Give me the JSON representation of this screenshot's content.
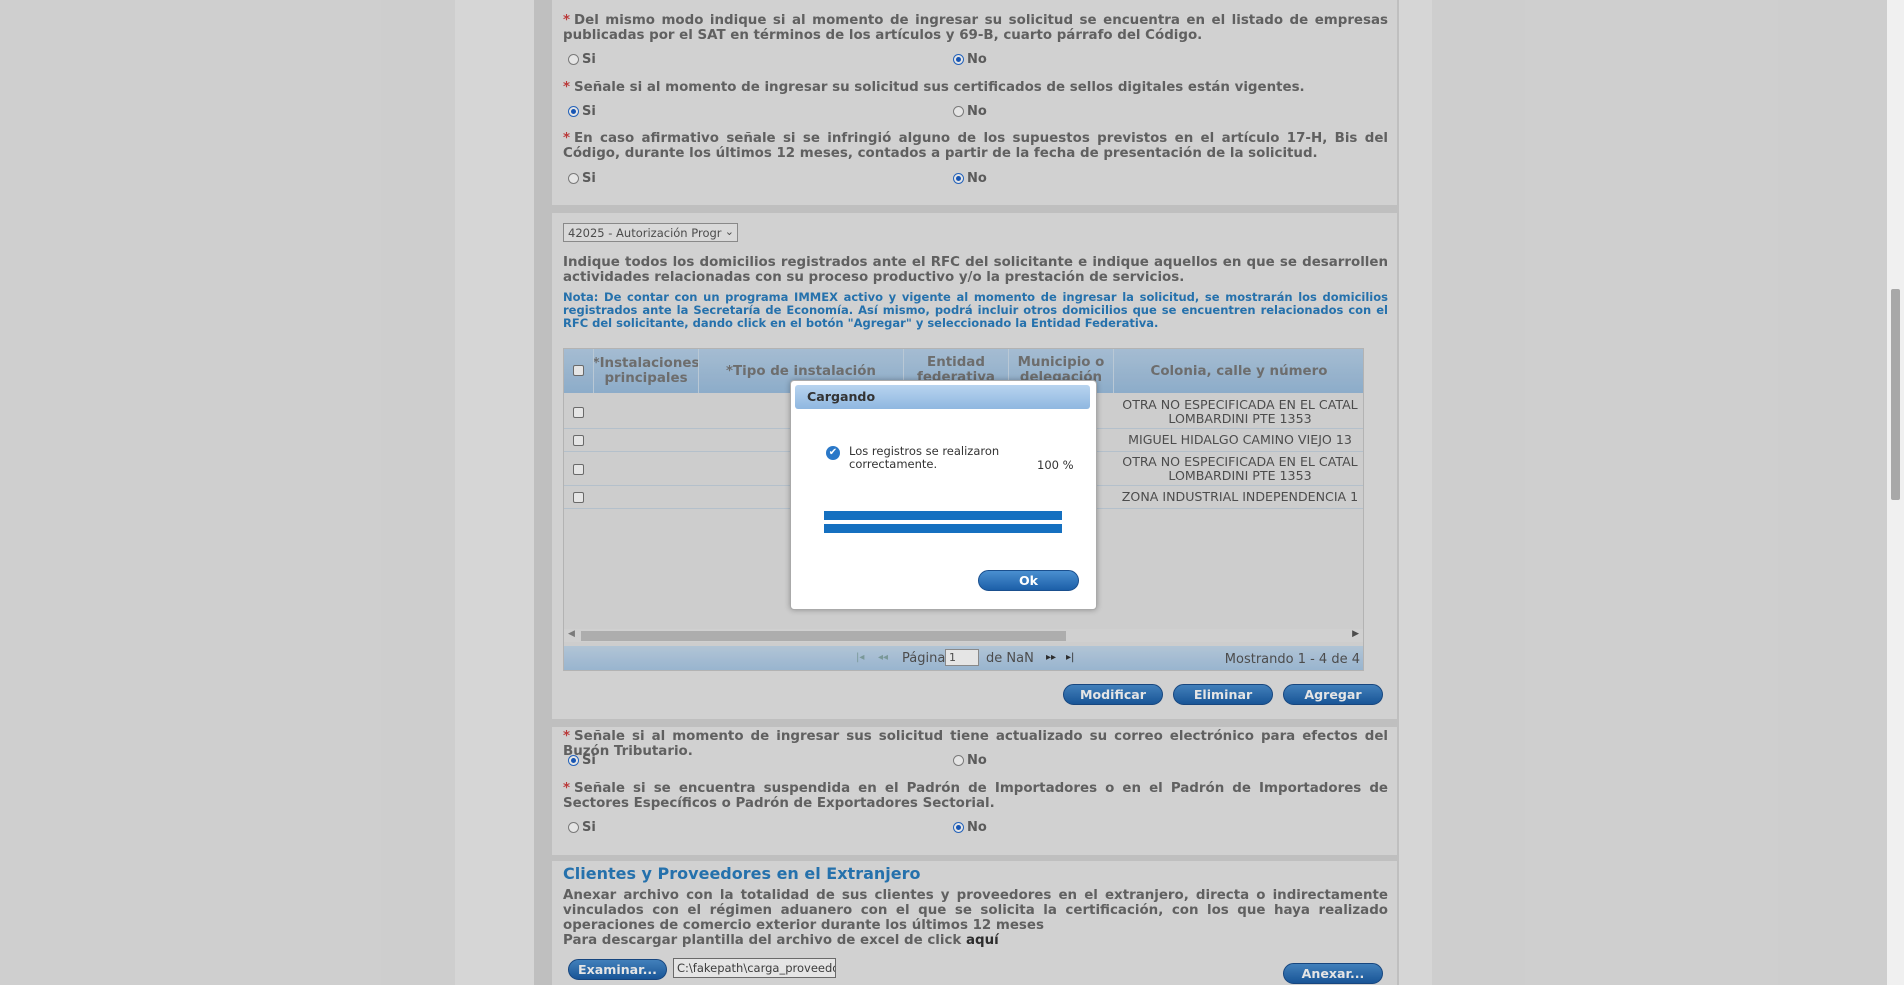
{
  "questions": {
    "q1": {
      "text": "Del mismo modo indique si al momento de ingresar su solicitud se encuentra en el listado de empresas publicadas por el SAT en términos de los artículos y 69-B, cuarto párrafo del Código.",
      "yes": "Si",
      "no": "No"
    },
    "q2": {
      "text": "Señale si al momento de ingresar su solicitud sus certificados de sellos digitales están vigentes.",
      "yes": "Si",
      "no": "No"
    },
    "q3": {
      "text": "En caso afirmativo señale si se infringió alguno de los supuestos previstos en el artículo 17-H, Bis del Código, durante los últimos 12 meses, contados a partir de la fecha de presentación de la solicitud.",
      "yes": "Si",
      "no": "No"
    },
    "q4": {
      "text": "Señale si al momento de ingresar sus solicitud tiene actualizado su correo electrónico para efectos del Buzón Tributario.",
      "yes": "Si",
      "no": "No"
    },
    "q5": {
      "text": "Señale si se encuentra suspendida en el Padrón de Importadores o en el Padrón de Importadores de Sectores Específicos o Padrón de Exportadores Sectorial.",
      "yes": "Si",
      "no": "No"
    }
  },
  "program_select": {
    "value": "42025 - Autorización Progr"
  },
  "domicilios": {
    "description": "Indique todos los domicilios registrados ante el RFC del solicitante e indique aquellos en que se desarrollen actividades relacionadas con su proceso productivo y/o la prestación de servicios.",
    "note": "Nota: De contar con un programa IMMEX activo y vigente al momento de ingresar la solicitud, se mostrarán los domicilios registrados ante la Secretaría de Economía. Así mismo, podrá incluir otros domicilios que se encuentren relacionados con el RFC del solicitante, dando click en el botón \"Agregar\" y seleccionado la Entidad Federativa."
  },
  "grid": {
    "headers": [
      "*Instalaciones principales",
      "*Tipo de instalación",
      "Entidad federativa",
      "Municipio o delegación",
      "Colonia, calle y número"
    ],
    "rows": [
      {
        "colonia_l1": "OTRA NO ESPECIFICADA EN EL CATAL",
        "colonia_l2": "LOMBARDINI PTE 1353"
      },
      {
        "colonia_l1": "MIGUEL HIDALGO CAMINO VIEJO 13",
        "colonia_l2": ""
      },
      {
        "colonia_l1": "OTRA NO ESPECIFICADA EN EL CATAL",
        "colonia_l2": "LOMBARDINI PTE 1353"
      },
      {
        "colonia_l1": "ZONA INDUSTRIAL INDEPENDENCIA 1",
        "colonia_l2": ""
      }
    ],
    "pager": {
      "page_label": "Página",
      "page_value": "1",
      "of_label": "de NaN",
      "showing": "Mostrando 1 - 4 de 4"
    }
  },
  "buttons": {
    "modify": "Modificar",
    "delete": "Eliminar",
    "add": "Agregar",
    "browse": "Examinar...",
    "attach": "Anexar...",
    "ok": "Ok"
  },
  "clientes": {
    "title": "Clientes y Proveedores en el Extranjero",
    "text": "Anexar archivo con la totalidad de sus clientes y proveedores en el extranjero, directa o indirectamente vinculados con el régimen aduanero con el que se solicita la certificación, con los que haya realizado operaciones de comercio exterior durante los últimos 12 meses",
    "download_text": "Para descargar plantilla del archivo de excel de click",
    "download_link": "aquí",
    "file_value": "C:\\fakepath\\carga_proveedo"
  },
  "dialog": {
    "title": "Cargando",
    "message": "Los registros se realizaron correctamente.",
    "percent": "100 %",
    "progress": 1.0
  },
  "colors": {
    "accent": "#2a7ec0",
    "button": "#1c5fa8",
    "required": "#d04040"
  }
}
